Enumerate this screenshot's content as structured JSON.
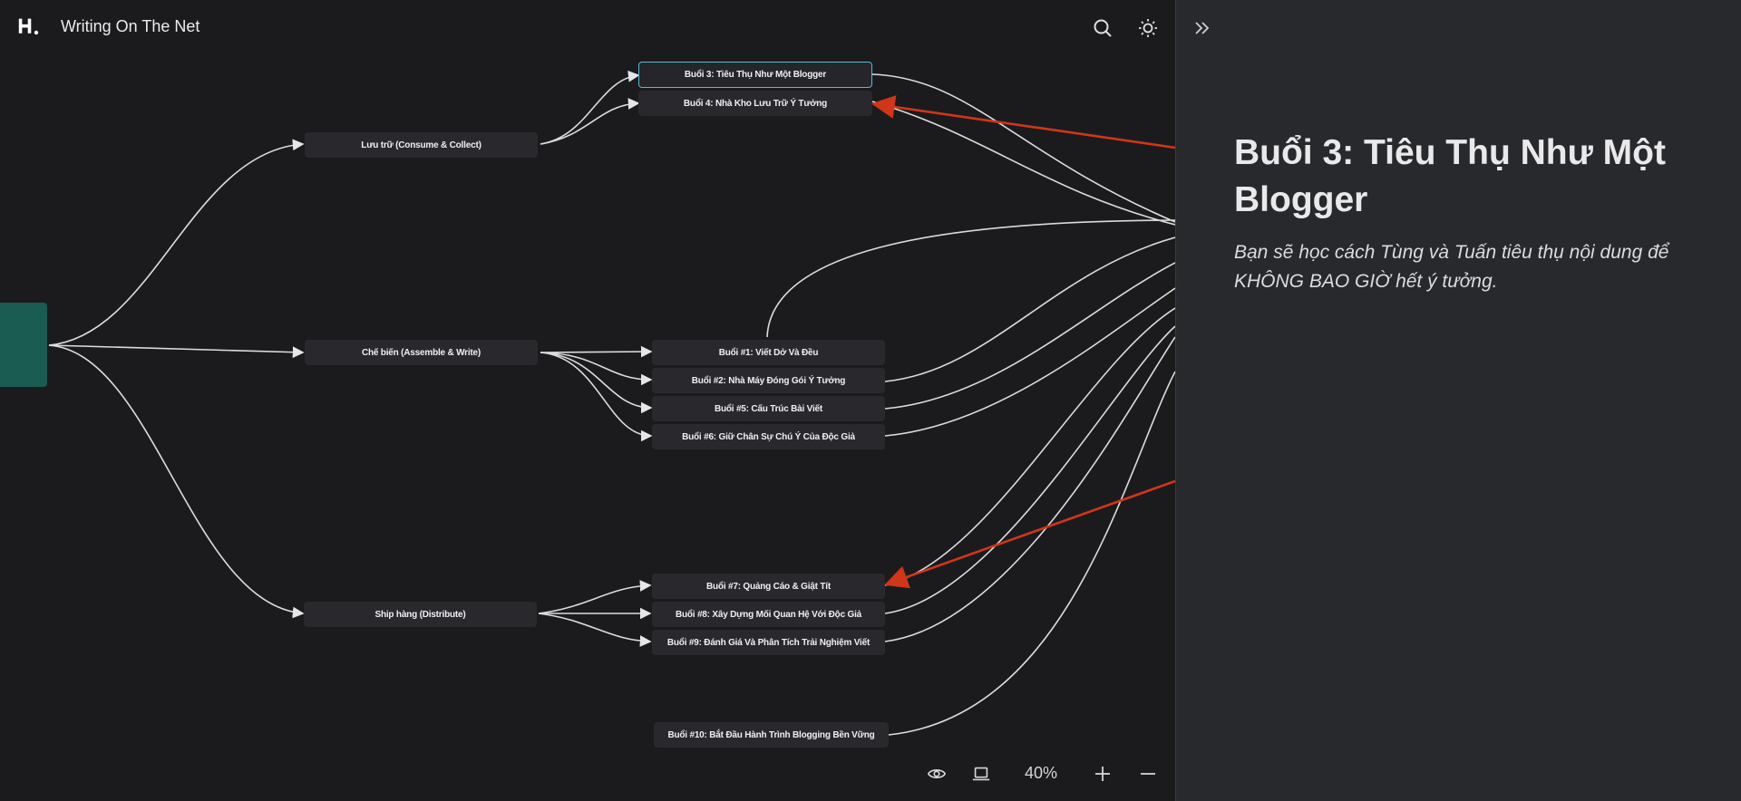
{
  "app": {
    "title": "Writing On The Net",
    "logo": "H."
  },
  "topbar": {
    "search_icon": "search-icon",
    "theme_icon": "sun-icon"
  },
  "mindmap": {
    "branches": {
      "consume": "Lưu trữ (Consume & Collect)",
      "assemble": "Chế biến (Assemble & Write)",
      "distribute": "Ship hàng (Distribute)"
    },
    "lessons": {
      "b3": "Buổi 3: Tiêu Thụ Như Một Blogger",
      "b4": "Buổi 4: Nhà Kho Lưu Trữ Ý Tưởng",
      "b1": "Buổi #1: Viết Dở Và Đều",
      "b2": "Buổi #2: Nhà Máy Đóng Gói Ý Tưởng",
      "b5": "Buổi #5: Cấu Trúc Bài Viết",
      "b6": "Buổi #6: Giữ Chân Sự Chú Ý Của Độc Giả",
      "b7": "Buổi #7: Quảng Cáo & Giật Tít",
      "b8": "Buổi #8: Xây Dựng Mối Quan Hệ Với Độc Giả",
      "b9": "Buổi #9: Đánh Giá Và Phân Tích Trải Nghiệm Viết",
      "b10": "Buổi #10: Bắt Đầu Hành Trình Blogging Bền Vững"
    }
  },
  "bottom_bar": {
    "zoom": "40%"
  },
  "panel": {
    "title": "Buổi 3: Tiêu Thụ Như Một Blogger",
    "description": "Bạn sẽ học cách Tùng và Tuấn tiêu thụ nội dung để KHÔNG BAO GIỜ hết ý tưởng."
  },
  "colors": {
    "accent": "#58b9d6",
    "root": "#1a5b52",
    "annotation": "#d0361a"
  }
}
